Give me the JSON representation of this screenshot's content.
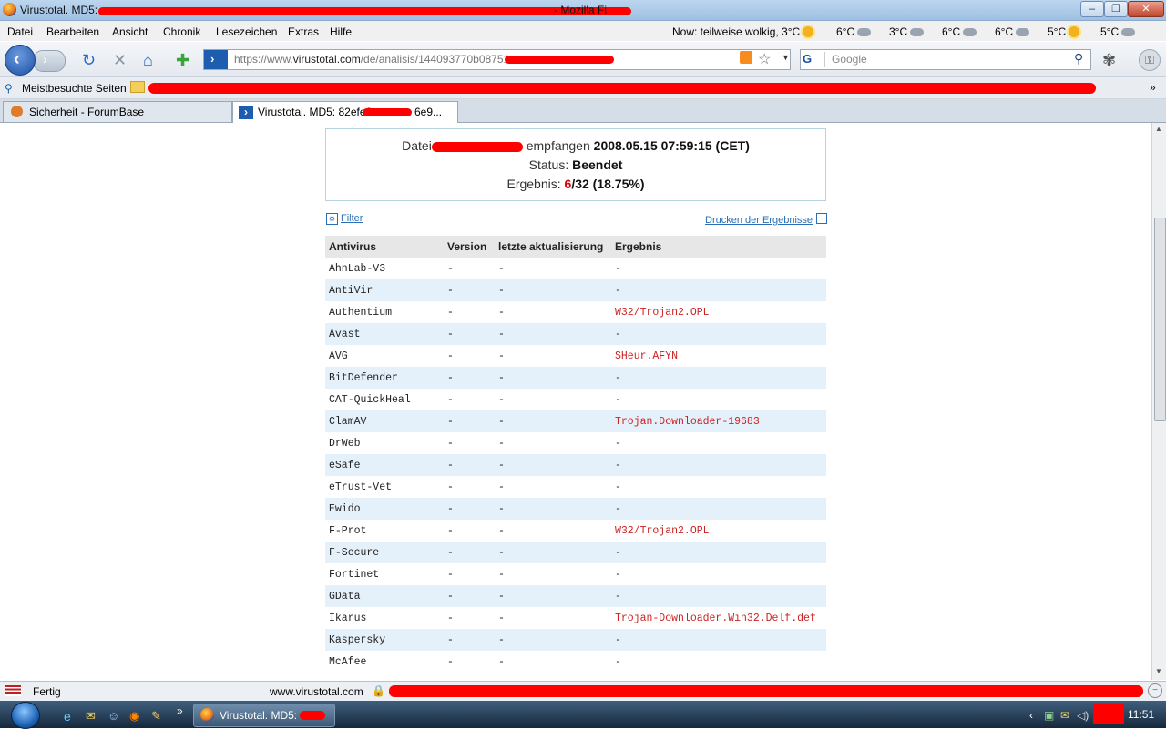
{
  "window": {
    "title": "Virustotal. MD5:",
    "title_suffix": "- Mozilla Fi",
    "controls": {
      "minimize": "–",
      "maximize": "❐",
      "close": "✕"
    }
  },
  "menu": [
    "Datei",
    "Bearbeiten",
    "Ansicht",
    "Chronik",
    "Lesezeichen",
    "Extras",
    "Hilfe"
  ],
  "weather": {
    "now": "Now: teilweise wolkig, 3°C",
    "forecast": [
      "6°C",
      "3°C",
      "6°C",
      "6°C",
      "5°C",
      "5°C"
    ]
  },
  "nav": {
    "url_prefix": "https://www.",
    "url_domain": "virustotal.com",
    "url_path": "/de/analisis/144093770b08751",
    "search_placeholder": "Google"
  },
  "bookmarks": {
    "most_visited": "Meistbesuchte Seiten"
  },
  "tabs": [
    {
      "label": "Sicherheit - ForumBase",
      "active": false
    },
    {
      "label": "Virustotal. MD5: 82efe6",
      "label_end": "6e9...",
      "active": true
    }
  ],
  "summary": {
    "datei_label": "Datei",
    "empfangen_label": "empfangen",
    "empfangen_value": "2008.05.15 07:59:15 (CET)",
    "status_label": "Status:",
    "status_value": "Beendet",
    "ergebnis_label": "Ergebnis:",
    "ergebnis_hits": "6",
    "ergebnis_rest": "/32 (18.75%)"
  },
  "links": {
    "filter": "Filter",
    "print": "Drucken der Ergebnisse"
  },
  "table": {
    "headers": [
      "Antivirus",
      "Version",
      "letzte aktualisierung",
      "Ergebnis"
    ],
    "rows": [
      {
        "av": "AhnLab-V3",
        "version": "-",
        "update": "-",
        "result": "-"
      },
      {
        "av": "AntiVir",
        "version": "-",
        "update": "-",
        "result": "-"
      },
      {
        "av": "Authentium",
        "version": "-",
        "update": "-",
        "result": "W32/Trojan2.OPL"
      },
      {
        "av": "Avast",
        "version": "-",
        "update": "-",
        "result": "-"
      },
      {
        "av": "AVG",
        "version": "-",
        "update": "-",
        "result": "SHeur.AFYN"
      },
      {
        "av": "BitDefender",
        "version": "-",
        "update": "-",
        "result": "-"
      },
      {
        "av": "CAT-QuickHeal",
        "version": "-",
        "update": "-",
        "result": "-"
      },
      {
        "av": "ClamAV",
        "version": "-",
        "update": "-",
        "result": "Trojan.Downloader-19683"
      },
      {
        "av": "DrWeb",
        "version": "-",
        "update": "-",
        "result": "-"
      },
      {
        "av": "eSafe",
        "version": "-",
        "update": "-",
        "result": "-"
      },
      {
        "av": "eTrust-Vet",
        "version": "-",
        "update": "-",
        "result": "-"
      },
      {
        "av": "Ewido",
        "version": "-",
        "update": "-",
        "result": "-"
      },
      {
        "av": "F-Prot",
        "version": "-",
        "update": "-",
        "result": "W32/Trojan2.OPL"
      },
      {
        "av": "F-Secure",
        "version": "-",
        "update": "-",
        "result": "-"
      },
      {
        "av": "Fortinet",
        "version": "-",
        "update": "-",
        "result": "-"
      },
      {
        "av": "GData",
        "version": "-",
        "update": "-",
        "result": "-"
      },
      {
        "av": "Ikarus",
        "version": "-",
        "update": "-",
        "result": "Trojan-Downloader.Win32.Delf.def"
      },
      {
        "av": "Kaspersky",
        "version": "-",
        "update": "-",
        "result": "-"
      },
      {
        "av": "McAfee",
        "version": "-",
        "update": "-",
        "result": "-"
      }
    ]
  },
  "status": {
    "text": "Fertig",
    "host": "www.virustotal.com"
  },
  "taskbar": {
    "task": "Virustotal. MD5:",
    "clock": "11:51"
  }
}
